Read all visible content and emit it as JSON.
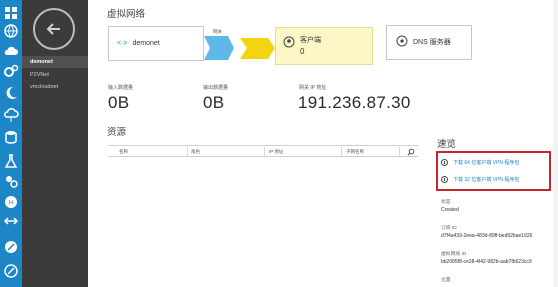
{
  "page": {
    "title": "虚拟网络"
  },
  "nav": {
    "items": [
      {
        "label": "demonet",
        "active": true
      },
      {
        "label": "P2VNet",
        "active": false
      },
      {
        "label": "vmcloudnet",
        "active": false
      }
    ]
  },
  "diagram": {
    "network_name": "demonet",
    "link_label": "网关",
    "client_title": "客户端",
    "client_count": "0",
    "dns_label": "DNS 服务器"
  },
  "stats": [
    {
      "label": "输入数据量",
      "value": "0B"
    },
    {
      "label": "输出数据量",
      "value": "0B"
    },
    {
      "label": "网关 IP 地址",
      "value": "191.236.87.30"
    }
  ],
  "resources": {
    "title": "资源",
    "columns": [
      "名称",
      "角色",
      "IP 地址",
      "子网名称"
    ]
  },
  "quick": {
    "title": "速览",
    "download_64": "下载 64 位客户端 VPN 程序包",
    "download_32": "下载 32 位客户端 VPN 程序包",
    "status_label": "状态",
    "status_value": "Created",
    "sub_id_label": "订阅 ID",
    "sub_id_value": "d7f4a439-2eea-483d-89ff-bed92bae1926",
    "vnet_id_label": "虚拟网络 ID",
    "vnet_id_value": "bb2085f8-ce38-4f42-982b-aab7fb623cc9",
    "location_label": "位置"
  },
  "colors": {
    "rail": "#1c86c6",
    "nav_bg": "#3b3b3b",
    "client_box": "#fdf6c6",
    "highlight": "#c1272d",
    "link": "#1c86c6"
  }
}
